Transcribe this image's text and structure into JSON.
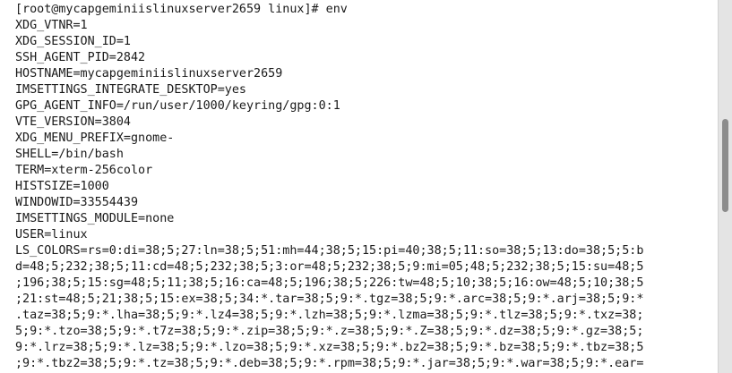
{
  "terminal": {
    "lines": [
      "[root@mycapgeminiislinuxserver2659 linux]# env",
      "XDG_VTNR=1",
      "XDG_SESSION_ID=1",
      "SSH_AGENT_PID=2842",
      "HOSTNAME=mycapgeminiislinuxserver2659",
      "IMSETTINGS_INTEGRATE_DESKTOP=yes",
      "GPG_AGENT_INFO=/run/user/1000/keyring/gpg:0:1",
      "VTE_VERSION=3804",
      "XDG_MENU_PREFIX=gnome-",
      "SHELL=/bin/bash",
      "TERM=xterm-256color",
      "HISTSIZE=1000",
      "WINDOWID=33554439",
      "IMSETTINGS_MODULE=none",
      "USER=linux",
      "LS_COLORS=rs=0:di=38;5;27:ln=38;5;51:mh=44;38;5;15:pi=40;38;5;11:so=38;5;13:do=38;5;5:b",
      "d=48;5;232;38;5;11:cd=48;5;232;38;5;3:or=48;5;232;38;5;9:mi=05;48;5;232;38;5;15:su=48;5",
      ";196;38;5;15:sg=48;5;11;38;5;16:ca=48;5;196;38;5;226:tw=48;5;10;38;5;16:ow=48;5;10;38;5",
      ";21:st=48;5;21;38;5;15:ex=38;5;34:*.tar=38;5;9:*.tgz=38;5;9:*.arc=38;5;9:*.arj=38;5;9:*",
      ".taz=38;5;9:*.lha=38;5;9:*.lz4=38;5;9:*.lzh=38;5;9:*.lzma=38;5;9:*.tlz=38;5;9:*.txz=38;",
      "5;9:*.tzo=38;5;9:*.t7z=38;5;9:*.zip=38;5;9:*.z=38;5;9:*.Z=38;5;9:*.dz=38;5;9:*.gz=38;5;",
      "9:*.lrz=38;5;9:*.lz=38;5;9:*.lzo=38;5;9:*.xz=38;5;9:*.bz2=38;5;9:*.bz=38;5;9:*.tbz=38;5",
      ";9:*.tbz2=38;5;9:*.tz=38;5;9:*.deb=38;5;9:*.rpm=38;5;9:*.jar=38;5;9:*.war=38;5;9:*.ear="
    ]
  },
  "colors": {
    "background": "#ffffff",
    "text": "#1a1a1a",
    "scrollbar_track": "#e4e4e4",
    "scrollbar_thumb": "#8c8c8c"
  },
  "scroll": {
    "position_fraction": 0.32,
    "visible_fraction": 0.25
  }
}
